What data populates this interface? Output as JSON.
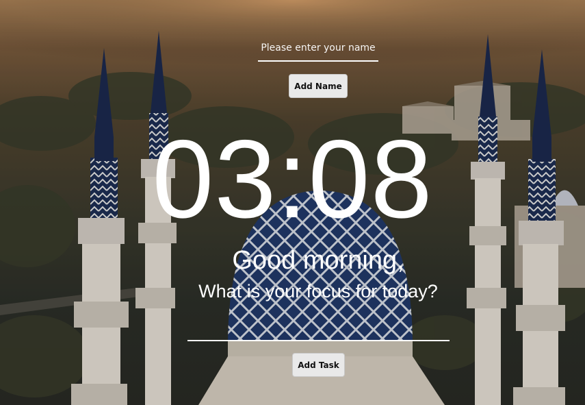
{
  "name_section": {
    "placeholder": "Please enter your name",
    "value": "",
    "button_label": "Add Name"
  },
  "clock": {
    "time": "03:08"
  },
  "greeting": {
    "text": "Good morning,",
    "question": "What is your focus for today?"
  },
  "task_section": {
    "value": "",
    "button_label": "Add Task"
  },
  "background": {
    "subject": "mosque-with-blue-dome-and-minarets-aerial-photo",
    "dome_color": "#2f4d8a",
    "minaret_color": "#e8e1d6"
  }
}
